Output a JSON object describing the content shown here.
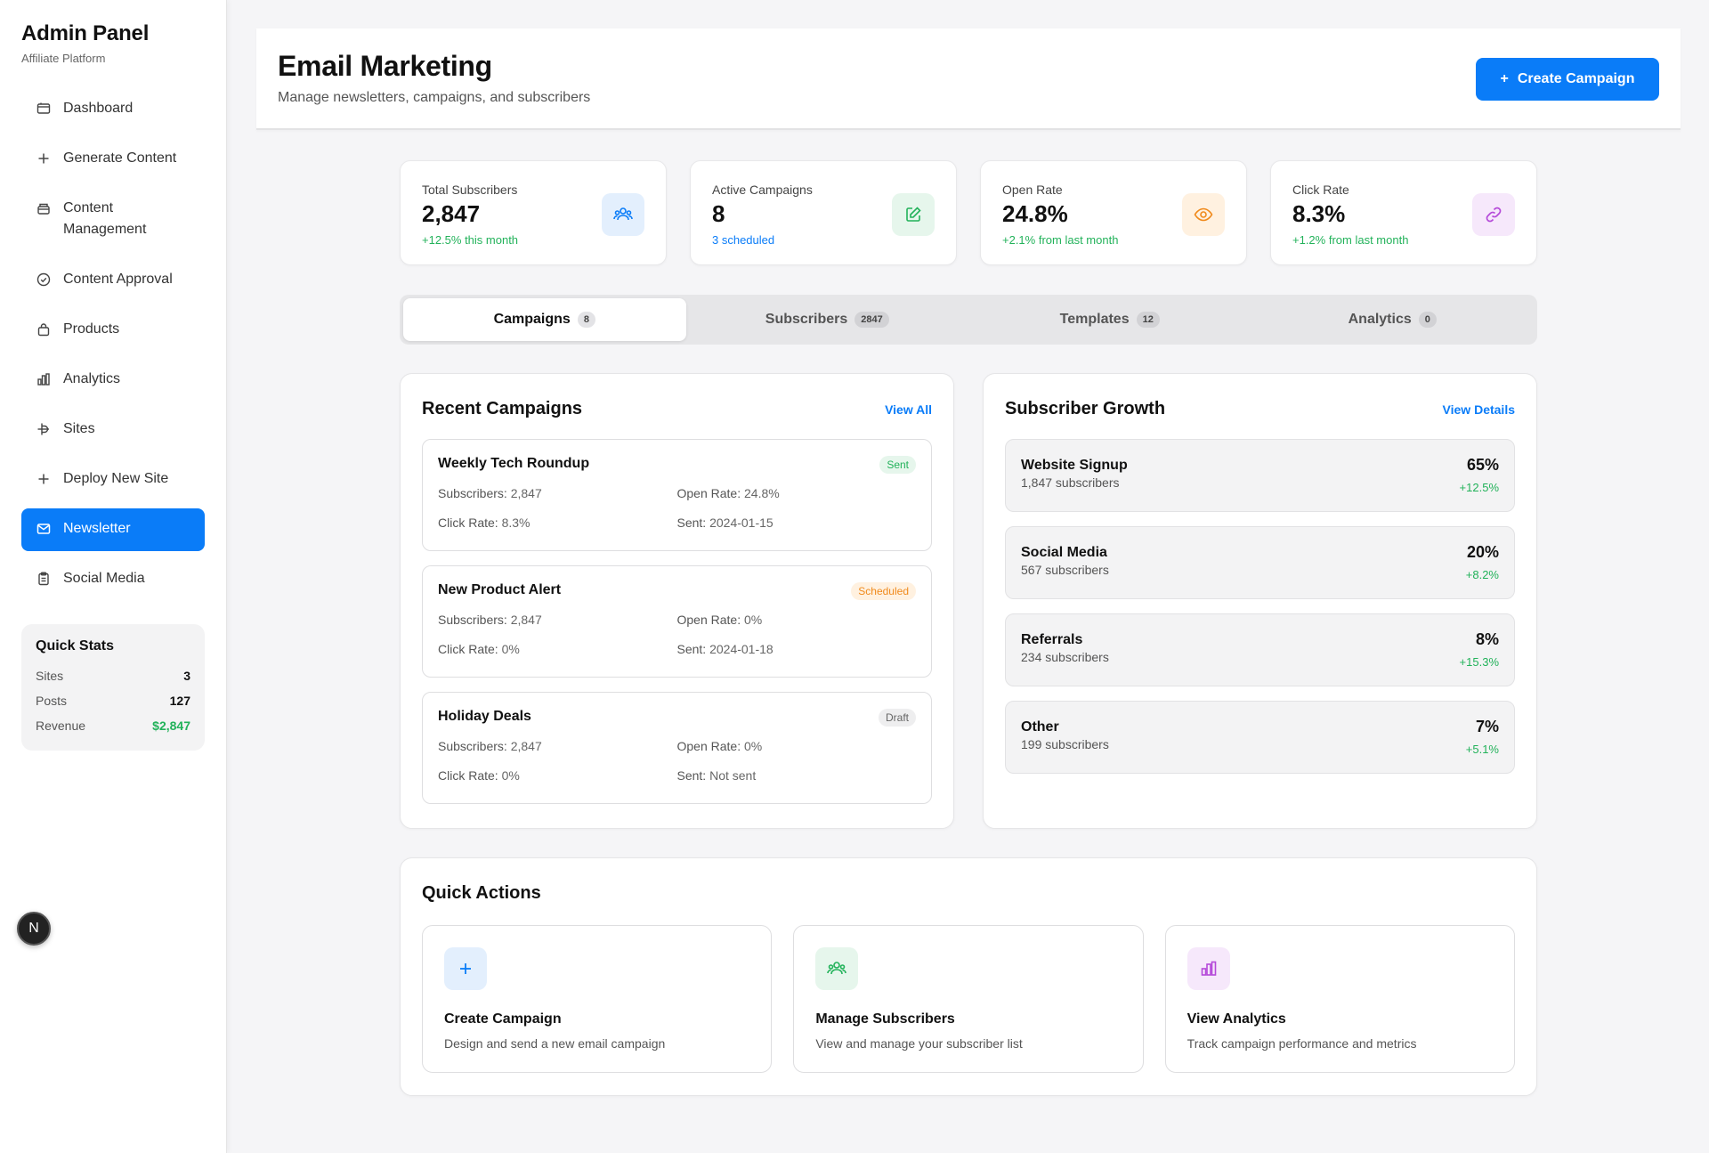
{
  "sidebar": {
    "title": "Admin Panel",
    "subtitle": "Affiliate Platform",
    "items": [
      {
        "label": "Dashboard",
        "icon": "dashboard-icon"
      },
      {
        "label": "Generate Content",
        "icon": "plus-icon"
      },
      {
        "label": "Content Management",
        "icon": "archive-icon"
      },
      {
        "label": "Content Approval",
        "icon": "check-circle-icon"
      },
      {
        "label": "Products",
        "icon": "bag-icon"
      },
      {
        "label": "Analytics",
        "icon": "bar-chart-icon"
      },
      {
        "label": "Sites",
        "icon": "sites-icon"
      },
      {
        "label": "Deploy New Site",
        "icon": "plus-icon"
      },
      {
        "label": "Newsletter",
        "icon": "mail-icon",
        "active": true
      },
      {
        "label": "Social Media",
        "icon": "clipboard-icon"
      }
    ],
    "quick_stats": {
      "title": "Quick Stats",
      "rows": [
        {
          "label": "Sites",
          "value": "3"
        },
        {
          "label": "Posts",
          "value": "127"
        },
        {
          "label": "Revenue",
          "value": "$2,847"
        }
      ]
    },
    "badge_letter": "N"
  },
  "header": {
    "title": "Email Marketing",
    "subtitle": "Manage newsletters, campaigns, and subscribers",
    "create_label": "Create Campaign",
    "create_icon": "+"
  },
  "stats": [
    {
      "title": "Total Subscribers",
      "value": "2,847",
      "sub": "+12.5% this month",
      "icon": "users-icon",
      "color": "#0a7cf8"
    },
    {
      "title": "Active Campaigns",
      "value": "8",
      "sub": "3 scheduled",
      "icon": "edit-icon",
      "color": "#22b25a"
    },
    {
      "title": "Open Rate",
      "value": "24.8%",
      "sub": "+2.1% from last month",
      "icon": "eye-icon",
      "color": "#f08a1c"
    },
    {
      "title": "Click Rate",
      "value": "8.3%",
      "sub": "+1.2% from last month",
      "icon": "link-icon",
      "color": "#b54ad9"
    }
  ],
  "tabs": [
    {
      "label": "Campaigns",
      "count": "8"
    },
    {
      "label": "Subscribers",
      "count": "2847"
    },
    {
      "label": "Templates",
      "count": "12"
    },
    {
      "label": "Analytics",
      "count": "0"
    }
  ],
  "recent_campaigns": {
    "title": "Recent Campaigns",
    "link": "View All",
    "labels": {
      "subscribers": "Subscribers:",
      "open_rate": "Open Rate:",
      "click_rate": "Click Rate:",
      "sent": "Sent:"
    },
    "items": [
      {
        "name": "Weekly Tech Roundup",
        "status": "Sent",
        "subscribers": "2,847",
        "open_rate": "24.8%",
        "click_rate": "8.3%",
        "sent": "2024-01-15"
      },
      {
        "name": "New Product Alert",
        "status": "Scheduled",
        "subscribers": "2,847",
        "open_rate": "0%",
        "click_rate": "0%",
        "sent": "2024-01-18"
      },
      {
        "name": "Holiday Deals",
        "status": "Draft",
        "subscribers": "2,847",
        "open_rate": "0%",
        "click_rate": "0%",
        "sent": "Not sent"
      }
    ]
  },
  "subscriber_growth": {
    "title": "Subscriber Growth",
    "link": "View Details",
    "items": [
      {
        "name": "Website Signup",
        "sub": "1,847 subscribers",
        "pct": "65%",
        "change": "+12.5%"
      },
      {
        "name": "Social Media",
        "sub": "567 subscribers",
        "pct": "20%",
        "change": "+8.2%"
      },
      {
        "name": "Referrals",
        "sub": "234 subscribers",
        "pct": "8%",
        "change": "+15.3%"
      },
      {
        "name": "Other",
        "sub": "199 subscribers",
        "pct": "7%",
        "change": "+5.1%"
      }
    ]
  },
  "quick_actions": {
    "title": "Quick Actions",
    "items": [
      {
        "title": "Create Campaign",
        "desc": "Design and send a new email campaign",
        "icon": "plus-icon",
        "color": "#0a7cf8"
      },
      {
        "title": "Manage Subscribers",
        "desc": "View and manage your subscriber list",
        "icon": "users-icon",
        "color": "#22b25a"
      },
      {
        "title": "View Analytics",
        "desc": "Track campaign performance and metrics",
        "icon": "bar-chart-icon",
        "color": "#b54ad9"
      }
    ]
  }
}
